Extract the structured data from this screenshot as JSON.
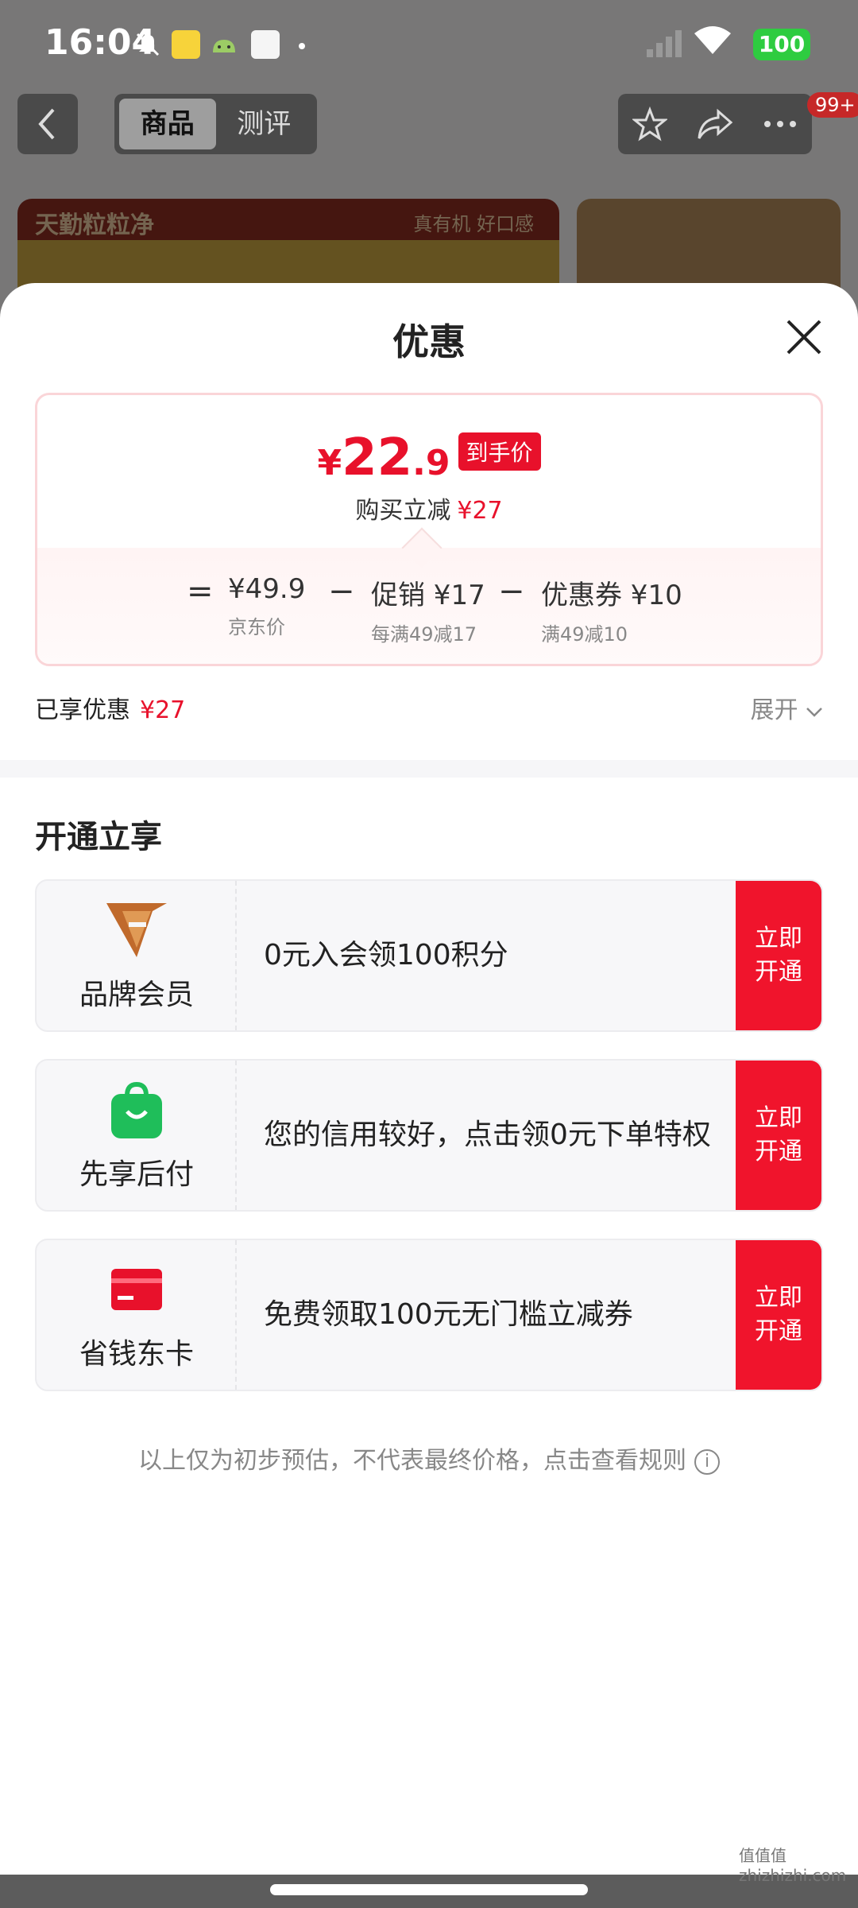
{
  "status_bar": {
    "time": "16:04",
    "battery": "100",
    "icons": [
      "mute-icon",
      "app-notify-icon",
      "android-icon",
      "app-icon",
      "dot"
    ]
  },
  "topnav": {
    "tabs": [
      {
        "label": "商品",
        "active": true
      },
      {
        "label": "测评",
        "active": false
      }
    ],
    "badge": "99+",
    "actions": [
      "star-icon",
      "share-icon",
      "more-icon"
    ]
  },
  "banner": {
    "title": "天勤粒粒净",
    "tag": "真有机 好口感"
  },
  "sheet": {
    "title": "优惠",
    "price": {
      "symbol": "¥",
      "integer": "22",
      "decimal": ".9",
      "tag": "到手价",
      "reduce_label": "购买立减",
      "reduce_value": "¥27"
    },
    "formula": [
      {
        "op": "="
      },
      {
        "main": "¥49.9",
        "sub": "京东价"
      },
      {
        "op": "−"
      },
      {
        "main": "促销 ¥17",
        "sub": "每满49减17"
      },
      {
        "op": "−"
      },
      {
        "main": "优惠券 ¥10",
        "sub": "满49减10"
      }
    ],
    "enjoyed_label": "已享优惠",
    "enjoyed_value": "¥27",
    "expand_label": "展开",
    "section_title": "开通立享",
    "benefits": [
      {
        "name": "品牌会员",
        "icon": "brand-member-icon",
        "desc": "0元入会领100积分",
        "button": "立即开通"
      },
      {
        "name": "先享后付",
        "icon": "shopping-bag-icon",
        "desc": "您的信用较好，点击领0元下单特权",
        "button": "立即开通"
      },
      {
        "name": "省钱东卡",
        "icon": "card-icon",
        "desc": "免费领取100元无门槛立减券",
        "button": "立即开通"
      }
    ],
    "footnote": "以上仅为初步预估，不代表最终价格，点击查看规则"
  },
  "watermark": "值值值 zhizhizhi.com",
  "colors": {
    "accent_red": "#e8112b",
    "button_red": "#f0142c",
    "battery_green": "#2ecc40"
  }
}
